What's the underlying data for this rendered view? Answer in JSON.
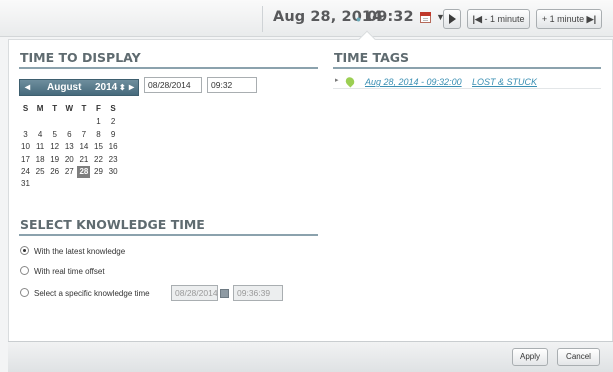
{
  "topbar": {
    "date": "Aug 28, 2014",
    "dot": "•",
    "time": "09:32",
    "minus_minute": "- 1 minute",
    "plus_minute": "+ 1 minute"
  },
  "time_to_display": {
    "title": "TIME TO DISPLAY",
    "month": "August",
    "year": "2014",
    "prev": "◂",
    "next": "▸",
    "year_spin": "⬍",
    "weekday_headers": [
      "S",
      "M",
      "T",
      "W",
      "T",
      "F",
      "S"
    ],
    "weeks": [
      [
        "",
        "",
        "",
        "",
        "",
        "1",
        "2"
      ],
      [
        "3",
        "4",
        "5",
        "6",
        "7",
        "8",
        "9"
      ],
      [
        "10",
        "11",
        "12",
        "13",
        "14",
        "15",
        "16"
      ],
      [
        "17",
        "18",
        "19",
        "20",
        "21",
        "22",
        "23"
      ],
      [
        "24",
        "25",
        "26",
        "27",
        "28",
        "29",
        "30"
      ],
      [
        "31",
        "",
        "",
        "",
        "",
        "",
        ""
      ]
    ],
    "selected_day": "28",
    "date_value": "08/28/2014",
    "time_value": "09:32"
  },
  "knowledge_time": {
    "title": "SELECT KNOWLEDGE TIME",
    "options": [
      {
        "label": "With the latest knowledge",
        "selected": true
      },
      {
        "label": "With real time offset",
        "selected": false
      },
      {
        "label": "Select a specific knowledge time",
        "selected": false
      }
    ],
    "date_value": "08/28/2014",
    "time_value": "09:36:39"
  },
  "time_tags": {
    "title": "TIME TAGS",
    "items": [
      {
        "time": "Aug 28, 2014 - 09:32:00",
        "name": "LOST & STUCK"
      }
    ]
  },
  "footer": {
    "apply": "Apply",
    "cancel": "Cancel"
  },
  "colors": {
    "accent": "#466a7c",
    "link": "#3a8fb3",
    "heading": "#5f6b70"
  }
}
